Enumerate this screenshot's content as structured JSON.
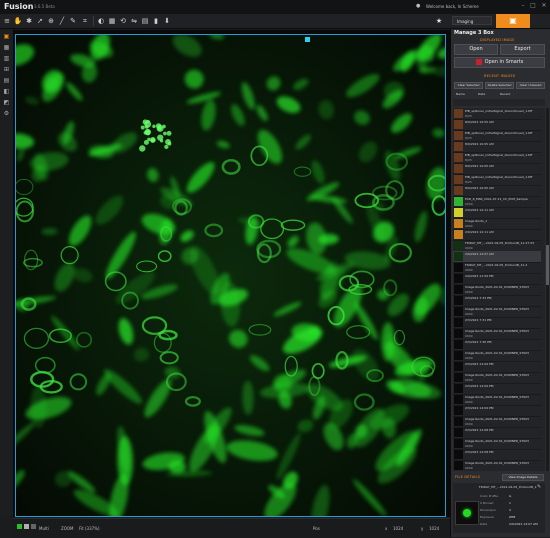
{
  "app": {
    "name": "Fusion",
    "version": "3.6.5 Beta",
    "user_label": "Welcome back, In Scheme",
    "mode": "Imaging"
  },
  "toolbar": {
    "send_label": "Send To..."
  },
  "panel": {
    "title": "Manage 3 Box",
    "displayed_image_label": "DISPLAYED IMAGE",
    "open_label": "Open",
    "export_label": "Export",
    "open_in_label": "Open in Smarts",
    "recent_images_label": "RECENT IMAGES",
    "buttons": [
      "Clear Selected",
      "Delete Selected",
      "Clear Unsaved"
    ],
    "sort_labels": [
      "Name",
      "Date",
      "Recent"
    ],
    "details_label": "FILE DETAILS",
    "view_details_label": "View Image Details",
    "detail_name": "FRIDAY_MT_...2021-02-05_ProtocolB_11-27-53_...",
    "detail_rows": [
      {
        "k": "Color Profile",
        "v": "G"
      },
      {
        "k": "X Binned",
        "v": "1"
      },
      {
        "k": "Dimension",
        "v": "4"
      },
      {
        "k": "Exposure",
        "v": "ZHB"
      },
      {
        "k": "Date",
        "v": "2/9/2021 12:07 AM"
      }
    ]
  },
  "files": [
    {
      "name": "EIB_spillover_initialSignal_discontinued_1.tiff",
      "date": "8/25",
      "thumb": "#6a3a1e"
    },
    {
      "name": "8/9/2021 10:05 AM",
      "date": "",
      "thumb": "#6a3a1e"
    },
    {
      "name": "EIB_spillover_initialSignal_discontinued_1.tiff",
      "date": "8/25",
      "thumb": "#6a3a1e"
    },
    {
      "name": "8/9/2021 10:05 AM",
      "date": "",
      "thumb": "#6a3a1e"
    },
    {
      "name": "EIB_spillover_initialSignal_discontinued_1.tiff",
      "date": "8/25",
      "thumb": "#6a3a1e"
    },
    {
      "name": "8/9/2021 10:05 AM",
      "date": "",
      "thumb": "#6a3a1e"
    },
    {
      "name": "EIB_spillover_initialSignal_discontinued_1.tiff",
      "date": "8/25",
      "thumb": "#6a3a1e"
    },
    {
      "name": "8/9/2021 10:05 AM",
      "date": "",
      "thumb": "#6a3a1e"
    },
    {
      "name": "ECR_6_MSR_2021-07-21_Ch_PCM_Sample",
      "date": "0000",
      "thumb": "#2fb52f"
    },
    {
      "name": "2/9/2021 12:11 AM",
      "date": "",
      "thumb": "#cfcf2f"
    },
    {
      "name": "Image Roots_1",
      "date": "0000",
      "thumb": "#c7801e"
    },
    {
      "name": "2/9/2021 12:11 AM",
      "date": "",
      "thumb": "#c7801e"
    },
    {
      "name": "FRIDAY_MT_...2021-02-05_ProtocolB_11-27-53",
      "date": "0000",
      "thumb": "#123012"
    },
    {
      "name": "2/9/2021 12:07 AM",
      "date": "",
      "thumb": "#123012"
    },
    {
      "name": "FRIDAY_MT_...2021-02-05_ProtocolB_11-2",
      "date": "0000",
      "thumb": "#0a0a0a"
    },
    {
      "name": "2/9/2021 11:59 PM",
      "date": "",
      "thumb": "#0a0a0a"
    },
    {
      "name": "Image Roots_2021-02-01_DOWNER_ST003",
      "date": "0000",
      "thumb": "#0a0a0a"
    },
    {
      "name": "2/3/2021 7:33 PM",
      "date": "",
      "thumb": "#0a0a0a"
    },
    {
      "name": "Image Roots_2021-02-01_DOWNER_ST003",
      "date": "0000",
      "thumb": "#0a0a0a"
    },
    {
      "name": "2/3/2021 7:31 PM",
      "date": "",
      "thumb": "#0a0a0a"
    },
    {
      "name": "Image Roots_2021-02-01_DOWNER_ST003",
      "date": "0000",
      "thumb": "#0a0a0a"
    },
    {
      "name": "2/3/2021 7:30 PM",
      "date": "",
      "thumb": "#0a0a0a"
    },
    {
      "name": "Image Roots_2021-02-01_DOWNER_ST003",
      "date": "0000",
      "thumb": "#0a0a0a"
    },
    {
      "name": "2/3/2021 12:09 PM",
      "date": "",
      "thumb": "#0a0a0a"
    },
    {
      "name": "Image Roots_2021-02-01_DOWNER_ST003",
      "date": "0000",
      "thumb": "#0a0a0a"
    },
    {
      "name": "2/3/2021 12:09 PM",
      "date": "",
      "thumb": "#0a0a0a"
    },
    {
      "name": "Image Roots_2021-02-01_DOWNER_ST003",
      "date": "0000",
      "thumb": "#0a0a0a"
    },
    {
      "name": "2/3/2021 12:09 PM",
      "date": "",
      "thumb": "#0a0a0a"
    },
    {
      "name": "Image Roots_2021-02-01_DOWNER_ST003",
      "date": "0000",
      "thumb": "#0a0a0a"
    },
    {
      "name": "2/3/2021 12:08 PM",
      "date": "",
      "thumb": "#0a0a0a"
    },
    {
      "name": "Image Roots_2021-02-01_DOWNER_ST003",
      "date": "0000",
      "thumb": "#0a0a0a"
    },
    {
      "name": "2/3/2021 12:08 PM",
      "date": "",
      "thumb": "#0a0a0a"
    },
    {
      "name": "Image Roots_2021-02-01_DOWNER_ST003",
      "date": "0000",
      "thumb": "#0a0a0a"
    }
  ],
  "selected_index": 13,
  "status": {
    "mode": "Multi",
    "zoom_label": "ZOOM",
    "fit_label": "Fit (337%)",
    "pos_label": "Pos",
    "x_label": "x",
    "x_value": "1024",
    "y_label": "y",
    "y_value": "1024"
  },
  "colors": {
    "accent": "#f08c1c",
    "selection": "#2a9bd6",
    "signal": "#27e827"
  }
}
